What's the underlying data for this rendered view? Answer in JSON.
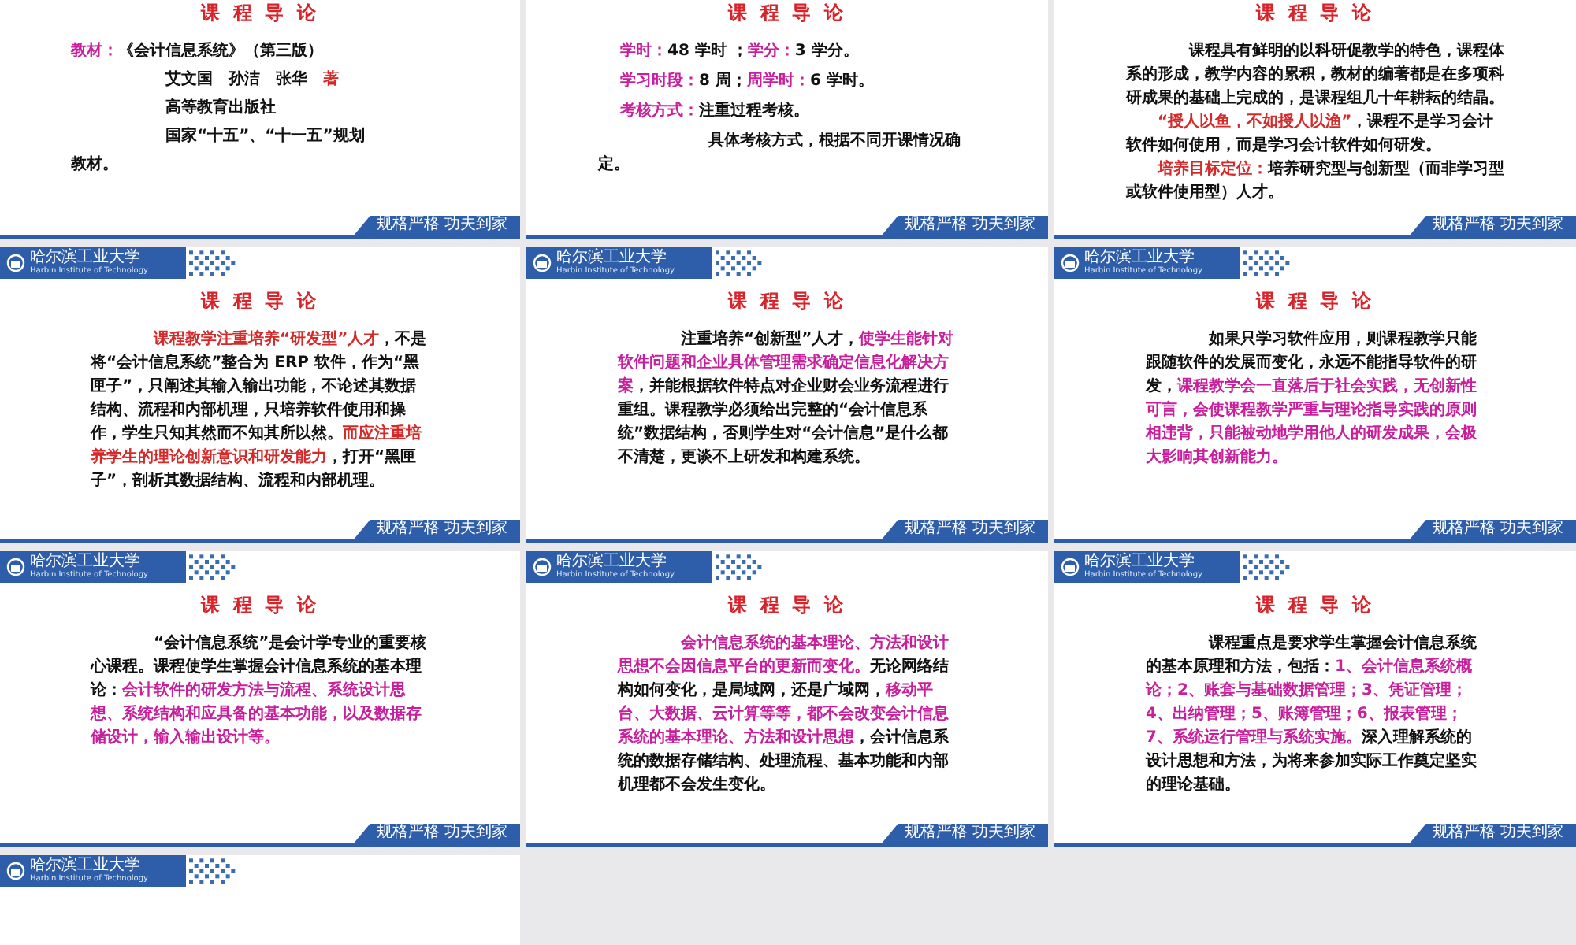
{
  "slides": [
    {
      "title": "课 程 导 论",
      "motto": "规格严格 功夫到家",
      "paragraphs": [
        {
          "kind": "plain",
          "runs": [
            {
              "text": "教材：",
              "color": "#c81f9c"
            },
            {
              "text": "《会计信息系统》（第三版）",
              "color": "#111111"
            }
          ]
        },
        {
          "kind": "hang",
          "runs": [
            {
              "text": "艾文国　孙洁　张华　",
              "color": "#111111"
            },
            {
              "text": "著",
              "color": "#d42a2a"
            }
          ]
        },
        {
          "kind": "hang",
          "runs": [
            {
              "text": "高等教育出版社",
              "color": "#111111"
            }
          ]
        },
        {
          "kind": "hang",
          "runs": [
            {
              "text": "国家“十五”、“十一五”规划",
              "color": "#111111"
            }
          ]
        },
        {
          "kind": "plain",
          "runs": [
            {
              "text": "教材。",
              "color": "#111111"
            }
          ]
        }
      ]
    },
    {
      "title": "课 程 导 论",
      "motto": "规格严格 功夫到家",
      "paragraphs": [
        {
          "kind": "hang-small",
          "runs": [
            {
              "text": "学时：",
              "color": "#c81f9c"
            },
            {
              "text": "48 学时 ；",
              "color": "#111111"
            },
            {
              "text": "学分：",
              "color": "#c81f9c"
            },
            {
              "text": "3 学分。",
              "color": "#111111"
            }
          ]
        },
        {
          "kind": "hang-small",
          "runs": [
            {
              "text": "学习时段：",
              "color": "#c81f9c"
            },
            {
              "text": "8 周；",
              "color": "#111111"
            },
            {
              "text": "周学时：",
              "color": "#c81f9c"
            },
            {
              "text": "6 学时。",
              "color": "#111111"
            }
          ]
        },
        {
          "kind": "hang-small",
          "runs": [
            {
              "text": "考核方式：",
              "color": "#c81f9c"
            },
            {
              "text": "注重过程考核。",
              "color": "#111111"
            }
          ]
        },
        {
          "kind": "indent-wide",
          "runs": [
            {
              "text": "具体考核方式，根据不同开课情况确定。",
              "color": "#111111"
            }
          ]
        }
      ]
    },
    {
      "title": "课 程 导 论",
      "motto": "规格严格 功夫到家",
      "paragraphs": [
        {
          "kind": "indent",
          "runs": [
            {
              "text": "课程具有鲜明的以科研促教学的特色，课程体系的形成，教学内容的累积，教材的编著都是在多项科研成果的基础上完成的，是课程组几十年耕耘的结晶。",
              "color": "#111111"
            }
          ]
        },
        {
          "kind": "indent-half",
          "runs": [
            {
              "text": "“授人以鱼，不如授人以渔”",
              "color": "#d42a2a"
            },
            {
              "text": "，课程不是学习会计软件如何使用，而是学习会计软件如何研发。",
              "color": "#111111"
            }
          ]
        },
        {
          "kind": "indent-half",
          "runs": [
            {
              "text": "培养目标定位：",
              "color": "#d42a2a"
            },
            {
              "text": "培养研究型与创新型（而非学习型或软件使用型）人才。",
              "color": "#111111"
            }
          ]
        }
      ]
    },
    {
      "title": "课 程 导 论",
      "header": {
        "name": "哈尔滨工业大学",
        "subtitle": "Harbin Institute of Technology"
      },
      "motto": "规格严格 功夫到家",
      "paragraphs": [
        {
          "kind": "indent",
          "runs": [
            {
              "text": "课程教学注重培养“研发型”人才",
              "color": "#d42a2a"
            },
            {
              "text": "，不是将“会计信息系统”整合为 ERP 软件，作为“黑匣子”，只阐述其输入输出功能，不论述其数据结构、流程和内部机理，只培养软件使用和操作，学生只知其然而不知其所以然。",
              "color": "#111111"
            },
            {
              "text": "而应注重培养学生的理论创新意识和研发能力",
              "color": "#d42a2a"
            },
            {
              "text": "，打开“黑匣子”，剖析其数据结构、流程和内部机理。",
              "color": "#111111"
            }
          ]
        }
      ]
    },
    {
      "title": "课 程 导 论",
      "header": {
        "name": "哈尔滨工业大学",
        "subtitle": "Harbin Institute of Technology"
      },
      "motto": "规格严格 功夫到家",
      "paragraphs": [
        {
          "kind": "indent",
          "runs": [
            {
              "text": "注重培养“创新型”人才，",
              "color": "#111111"
            },
            {
              "text": "使学生能针对软件问题和企业具体管理需求确定信息化解决方案",
              "color": "#c81f9c"
            },
            {
              "text": "，并能根据软件特点对企业财会业务流程进行重组。课程教学必须给出完整的“会计信息系统”数据结构，否则学生对“会计信息”是什么都不清楚，更谈不上研发和构建系统。",
              "color": "#111111"
            }
          ]
        }
      ]
    },
    {
      "title": "课 程 导 论",
      "header": {
        "name": "哈尔滨工业大学",
        "subtitle": "Harbin Institute of Technology"
      },
      "motto": "规格严格 功夫到家",
      "paragraphs": [
        {
          "kind": "indent",
          "runs": [
            {
              "text": "如果只学习软件应用，则课程教学只能跟随软件的发展而变化，永远不能指导软件的研发，",
              "color": "#111111"
            },
            {
              "text": "课程教学会一直落后于社会实践，无创新性可言，会使课程教学严重与理论指导实践的原则相违背，只能被动地学用他人的研发成果，会极大影响其创新能力。",
              "color": "#c81f9c"
            }
          ]
        }
      ]
    },
    {
      "title": "课 程 导 论",
      "header": {
        "name": "哈尔滨工业大学",
        "subtitle": "Harbin Institute of Technology"
      },
      "motto": "规格严格 功夫到家",
      "paragraphs": [
        {
          "kind": "indent",
          "runs": [
            {
              "text": "“会计信息系统”是会计学专业的重要核心课程。课程使学生掌握会计信息系统的基本理论：",
              "color": "#111111"
            },
            {
              "text": "会计软件的研发方法与流程、系统设计思想、系统结构和应具备的基本功能，以及数据存储设计，输入输出设计等。",
              "color": "#c81f9c"
            }
          ]
        }
      ]
    },
    {
      "title": "课 程 导 论",
      "header": {
        "name": "哈尔滨工业大学",
        "subtitle": "Harbin Institute of Technology"
      },
      "motto": "规格严格 功夫到家",
      "paragraphs": [
        {
          "kind": "indent",
          "runs": [
            {
              "text": "会计信息系统的基本理论、方法和设计思想不会因信息平台的更新而变化。",
              "color": "#c81f9c"
            },
            {
              "text": "无论网络结构如何变化，是局域网，还是广域网，",
              "color": "#111111"
            },
            {
              "text": "移动平台、大数据、云计算等等，都不会改变会计信息系统的基本理论、方法和设计思想",
              "color": "#c81f9c"
            },
            {
              "text": "，会计信息系统的数据存储结构、处理流程、基本功能和内部机理都不会发生变化。",
              "color": "#111111"
            }
          ]
        }
      ]
    },
    {
      "title": "课 程 导 论",
      "header": {
        "name": "哈尔滨工业大学",
        "subtitle": "Harbin Institute of Technology"
      },
      "motto": "规格严格 功夫到家",
      "paragraphs": [
        {
          "kind": "indent",
          "runs": [
            {
              "text": "课程重点是要求学生掌握会计信息系统的基本原理和方法，包括：",
              "color": "#111111"
            },
            {
              "text": "1、会计信息系统概论；2、账套与基础数据管理；3、凭证管理；4、出纳管理；5、账簿管理；6、报表管理；7、系统运行管理与系统实施。",
              "color": "#c81f9c"
            },
            {
              "text": "深入理解系统的设计思想和方法，为将来参加实际工作奠定坚实的理论基础。",
              "color": "#111111"
            }
          ]
        }
      ]
    },
    {
      "header": {
        "name": "哈尔滨工业大学",
        "subtitle": "Harbin Institute of Technology"
      }
    }
  ]
}
